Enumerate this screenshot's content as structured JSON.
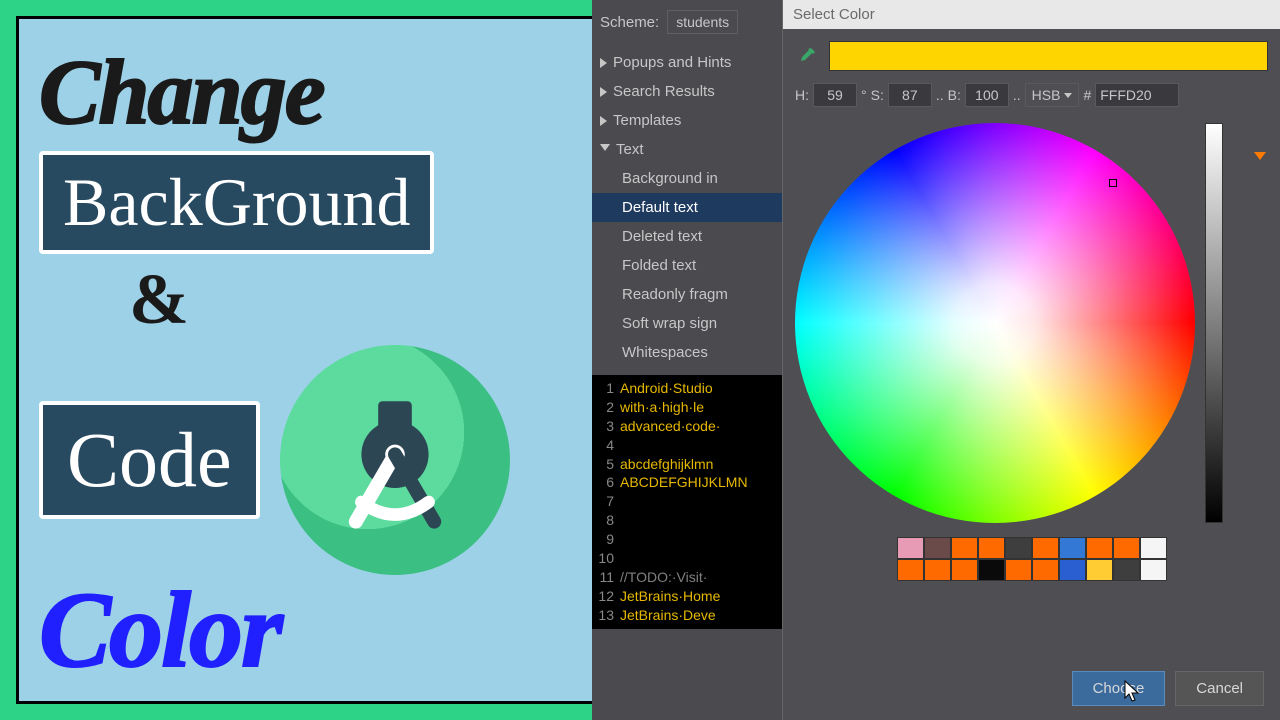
{
  "thumbnail": {
    "line1": "Change",
    "line2": "BackGround",
    "amp": "&",
    "line3": "Code",
    "line4": "Color"
  },
  "sidebar": {
    "scheme_label": "Scheme:",
    "scheme_value": "students",
    "items": [
      {
        "label": "Popups and Hints",
        "expanded": false
      },
      {
        "label": "Search Results",
        "expanded": false
      },
      {
        "label": "Templates",
        "expanded": false
      },
      {
        "label": "Text",
        "expanded": true
      }
    ],
    "text_children": [
      "Background in",
      "Default text",
      "Deleted text",
      "Folded text",
      "Readonly fragm",
      "Soft wrap sign",
      "Whitespaces"
    ],
    "selected_child": 1
  },
  "code": {
    "lines": [
      {
        "n": "1",
        "t": "Android·Studio",
        "cls": "txt"
      },
      {
        "n": "2",
        "t": "with·a·high·le",
        "cls": "txt"
      },
      {
        "n": "3",
        "t": "advanced·code·",
        "cls": "txt"
      },
      {
        "n": "4",
        "t": "",
        "cls": "txt"
      },
      {
        "n": "5",
        "t": "abcdefghijklmn",
        "cls": "txt"
      },
      {
        "n": "6",
        "t": "ABCDEFGHIJKLMN",
        "cls": "txt"
      },
      {
        "n": "7",
        "t": "",
        "cls": "txt"
      },
      {
        "n": "8",
        "t": "",
        "cls": "txt"
      },
      {
        "n": "9",
        "t": "",
        "cls": "txt"
      },
      {
        "n": "10",
        "t": "",
        "cls": "txt"
      },
      {
        "n": "11",
        "t": "//TODO:·Visit·",
        "cls": "cmt"
      },
      {
        "n": "12",
        "t": "JetBrains·Home",
        "cls": "txt"
      },
      {
        "n": "13",
        "t": "JetBrains·Deve",
        "cls": "txt"
      }
    ]
  },
  "dialog": {
    "title": "Select Color",
    "preview_hex": "#FFD500",
    "h_label": "H:",
    "h": "59",
    "deg": "°",
    "s_label": "S:",
    "s": "87",
    "dots1": "..",
    "b_label": "B:",
    "b": "100",
    "dots2": "..",
    "mode": "HSB",
    "hash": "#",
    "hex": "FFFD20",
    "swatches_row1": [
      "#e89bb4",
      "#6b4a4a",
      "#ff6a00",
      "#ff6a00",
      "#3e3e3e",
      "#ff6a00",
      "#3478d6",
      "#ff6a00",
      "#ff6a00",
      "#f5f5f5"
    ],
    "swatches_row2": [
      "#ff6a00",
      "#ff6a00",
      "#ff6a00",
      "#0a0a0a",
      "#ff6a00",
      "#ff6a00",
      "#2a5fd1",
      "#ffcc33",
      "#3e3e3e",
      "#f5f5f5"
    ],
    "choose": "Choose",
    "cancel": "Cancel"
  }
}
